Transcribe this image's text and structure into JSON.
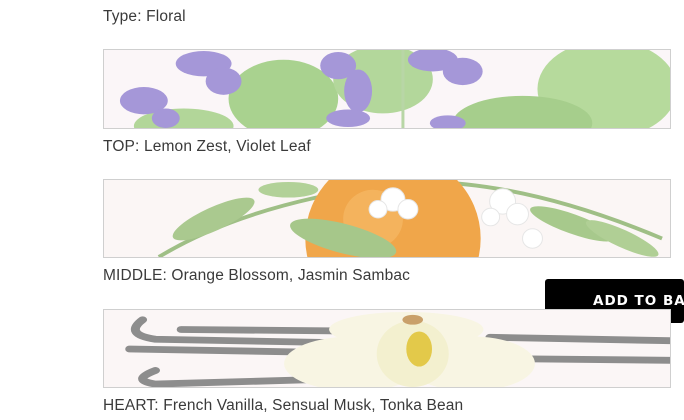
{
  "product": {
    "type_line": "Type: Floral",
    "notes": [
      {
        "label": "TOP: Lemon Zest, Violet Leaf",
        "image": "violet-leaf-image"
      },
      {
        "label": "MIDDLE: Orange Blossom, Jasmin Sambac",
        "image": "orange-blossom-image"
      },
      {
        "label": "HEART: French Vanilla, Sensual Musk, Tonka Bean",
        "image": "vanilla-flower-image"
      }
    ]
  },
  "cta": {
    "add_to_bag_label": "ADD TO BA"
  },
  "colors": {
    "violet": "#a99bd9",
    "leaf_green": "#a8cf8a",
    "orange": "#f0a64a",
    "vanilla_pod": "#8a8a8a",
    "button_bg": "#000000"
  }
}
